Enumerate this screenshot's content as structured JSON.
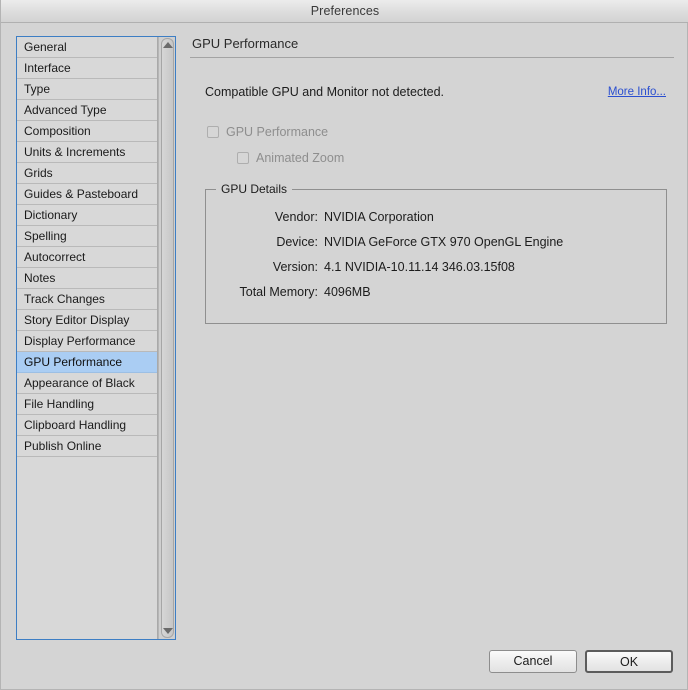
{
  "window": {
    "title": "Preferences"
  },
  "sidebar": {
    "items": [
      {
        "label": "General",
        "selected": false
      },
      {
        "label": "Interface",
        "selected": false
      },
      {
        "label": "Type",
        "selected": false
      },
      {
        "label": "Advanced Type",
        "selected": false
      },
      {
        "label": "Composition",
        "selected": false
      },
      {
        "label": "Units & Increments",
        "selected": false
      },
      {
        "label": "Grids",
        "selected": false
      },
      {
        "label": "Guides & Pasteboard",
        "selected": false
      },
      {
        "label": "Dictionary",
        "selected": false
      },
      {
        "label": "Spelling",
        "selected": false
      },
      {
        "label": "Autocorrect",
        "selected": false
      },
      {
        "label": "Notes",
        "selected": false
      },
      {
        "label": "Track Changes",
        "selected": false
      },
      {
        "label": "Story Editor Display",
        "selected": false
      },
      {
        "label": "Display Performance",
        "selected": false
      },
      {
        "label": "GPU Performance",
        "selected": true
      },
      {
        "label": "Appearance of Black",
        "selected": false
      },
      {
        "label": "File Handling",
        "selected": false
      },
      {
        "label": "Clipboard Handling",
        "selected": false
      },
      {
        "label": "Publish Online",
        "selected": false
      }
    ],
    "scroll_up_icon": "triangle-up-icon",
    "scroll_down_icon": "triangle-down-icon"
  },
  "main": {
    "panel_title": "GPU Performance",
    "status_text": "Compatible GPU and Monitor not detected.",
    "more_info_label": "More Info...",
    "checkboxes": [
      {
        "label": "GPU Performance",
        "checked": false,
        "enabled": false
      },
      {
        "label": "Animated Zoom",
        "checked": false,
        "enabled": false
      }
    ],
    "gpu_details": {
      "legend": "GPU Details",
      "rows": [
        {
          "label": "Vendor:",
          "value": "NVIDIA Corporation"
        },
        {
          "label": "Device:",
          "value": "NVIDIA GeForce GTX 970 OpenGL Engine"
        },
        {
          "label": "Version:",
          "value": "4.1 NVIDIA-10.11.14 346.03.15f08"
        },
        {
          "label": "Total Memory:",
          "value": "4096MB"
        }
      ]
    }
  },
  "footer": {
    "cancel_label": "Cancel",
    "ok_label": "OK"
  },
  "colors": {
    "window_bg": "#d4d4d4",
    "selection": "#aacdf3",
    "link": "#2b4fd0",
    "focus_border": "#3d7ec4",
    "disabled_text": "#8e8e8e"
  }
}
